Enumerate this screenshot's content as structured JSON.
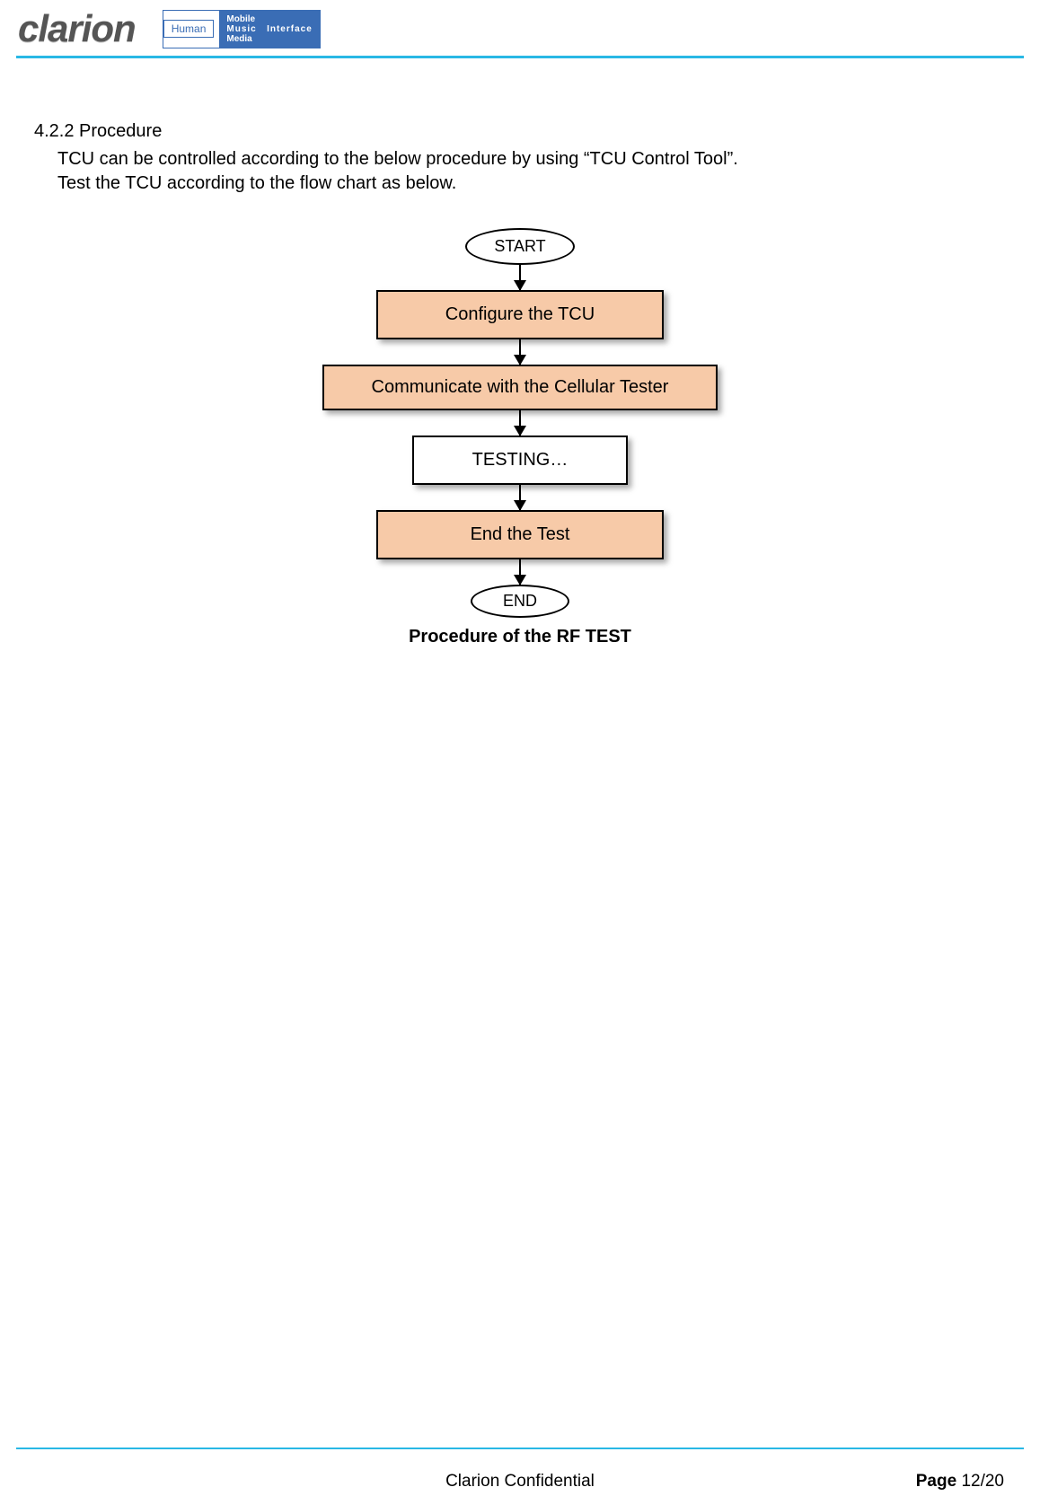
{
  "header": {
    "brand": "clarion",
    "human_label": "Human",
    "mmm_line1": "Mobile",
    "mmm_line2": "Music",
    "mmm_line3": "Media",
    "mmm_suffix": "Interface"
  },
  "section": {
    "number_title": "4.2.2 Procedure",
    "line1": "TCU can be controlled according to the below procedure by using “TCU Control Tool”.",
    "line2": "Test the TCU according to the flow chart as below."
  },
  "flow": {
    "start": "START",
    "step1": "Configure the TCU",
    "step2": "Communicate with the Cellular Tester",
    "step3": "TESTING…",
    "step4": "End the Test",
    "end": "END",
    "caption": "Procedure of the RF TEST"
  },
  "footer": {
    "confidential": "Clarion Confidential",
    "page_label": "Page ",
    "page_value": "12/20"
  }
}
